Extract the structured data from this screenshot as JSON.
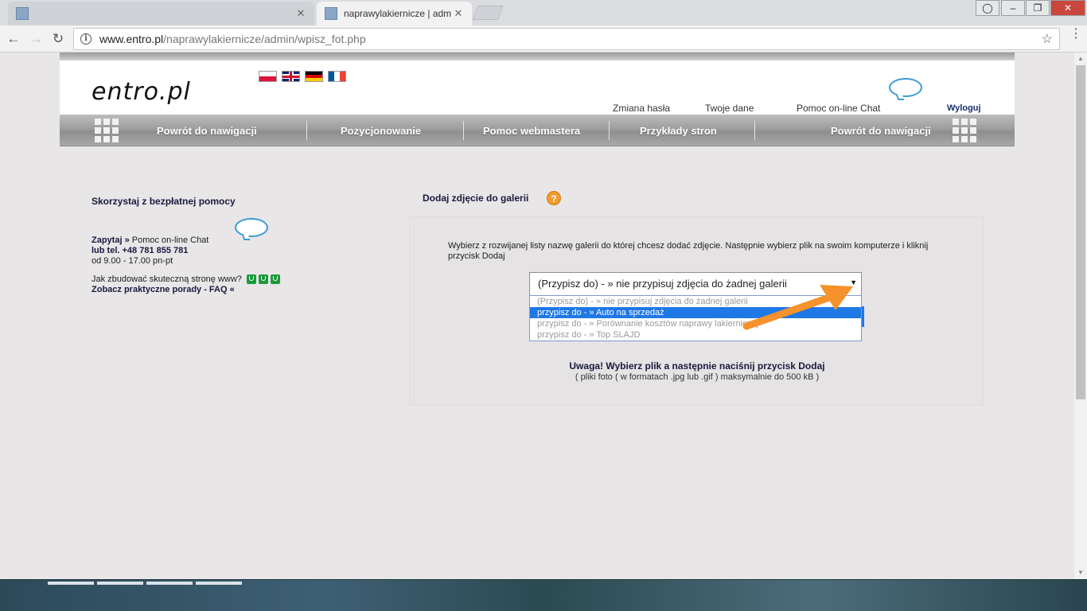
{
  "browser": {
    "tabs": [
      {
        "title": "",
        "active": false
      },
      {
        "title": "naprawylakiernicze | adm",
        "active": true
      }
    ],
    "url_host": "www.entro.pl",
    "url_path": "/naprawylakiernicze/admin/wpisz_fot.php"
  },
  "header": {
    "logo": "entro.pl",
    "links": {
      "change_password": "Zmiana hasła",
      "your_data": "Twoje dane",
      "online_help": "Pomoc on-line Chat",
      "logout": "Wyloguj"
    }
  },
  "nav": {
    "items": [
      "Powrót do nawigacji",
      "Pozycjonowanie",
      "Pomoc webmastera",
      "Przykłady stron",
      "Powrót do nawigacji"
    ]
  },
  "sidebar": {
    "title": "Skorzystaj z bezpłatnej pomocy",
    "ask": "Zapytaj »",
    "chat": "Pomoc on-line Chat",
    "phone": "lub tel. +48 781 855 781",
    "hours": "od 9.00 - 17.00 pn-pt",
    "question": "Jak zbudować skuteczną stronę www?",
    "faq": "Zobacz praktyczne porady - FAQ «"
  },
  "main": {
    "title": "Dodaj zdjęcie do galerii",
    "help": "?",
    "instructions": "Wybierz z rozwijanej listy nazwę galerii do której chcesz dodać zdjęcie. Następnie wybierz plik na swoim komputerze i kliknij przycisk Dodaj",
    "select_value": "(Przypisz do) - » nie przypisuj zdjęcia do żadnej galerii",
    "options": [
      "(Przypisz do) - » nie przypisuj zdjęcia do żadnej galerii",
      "przypisz do - » Auto na sprzedaż",
      "przypisz do - » Porównanie kosztów naprawy lakierniczej",
      "przypisz do - » Top SLAJD"
    ],
    "selected_option": 1,
    "warning": "Uwaga! Wybierz plik a następnie naciśnij przycisk Dodaj",
    "warning_sub": "( pliki foto ( w formatach .jpg lub .gif ) maksymalnie do 500 kB )"
  },
  "colors": {
    "accent_blue": "#1e78e6",
    "arrow_orange": "#f5922b",
    "help_orange": "#f29a2e"
  }
}
